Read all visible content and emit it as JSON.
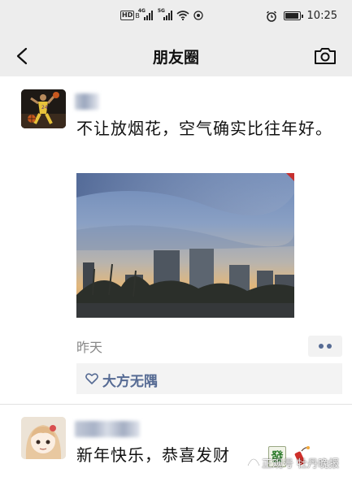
{
  "status_bar": {
    "left_badge": "HD",
    "left_badge_sub": "B",
    "signal1_label": "4G",
    "signal2_label": "5G",
    "time": "10:25",
    "battery_level": 0.85
  },
  "nav": {
    "title": "朋友圈"
  },
  "posts": [
    {
      "text": "不让放烟花，空气确实比往年好。",
      "time": "昨天",
      "likes": [
        "大方无隅"
      ]
    },
    {
      "text": "新年快乐，恭喜发财",
      "emoji_mahjong": "發"
    }
  ],
  "watermark": {
    "text": "正观号 牡丹晚报"
  },
  "icons": {
    "back": "back-icon",
    "camera": "camera-icon",
    "heart": "heart-icon",
    "alarm": "alarm-icon",
    "wifi": "wifi-icon",
    "battery": "battery-icon",
    "more": "more-icon"
  },
  "colors": {
    "bar_background": "#ededed",
    "link_blue": "#566b94",
    "meta_gray": "#888888",
    "like_box": "#f3f3f3"
  }
}
